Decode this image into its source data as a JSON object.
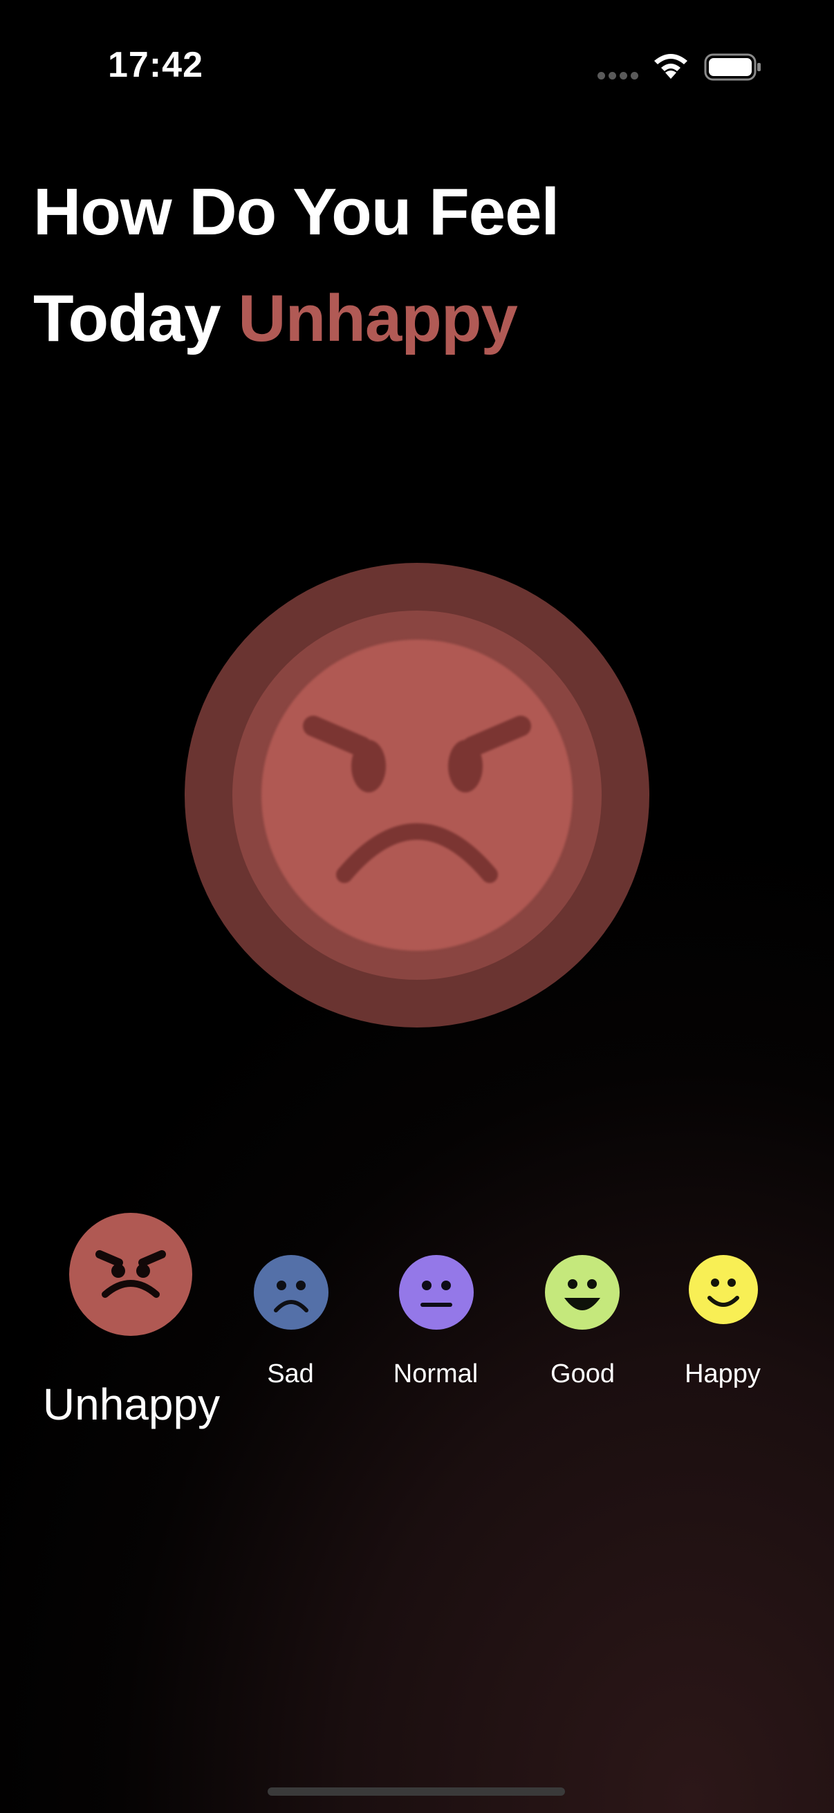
{
  "status_bar": {
    "time": "17:42"
  },
  "header": {
    "title_line1": "How Do You Feel",
    "title_line2_prefix": "Today",
    "selected_mood": "Unhappy"
  },
  "moods": [
    {
      "label": "Unhappy",
      "color": "#b05953",
      "icon": "angry-face-icon",
      "selected": true
    },
    {
      "label": "Sad",
      "color": "#5470a8",
      "icon": "sad-face-icon",
      "selected": false
    },
    {
      "label": "Normal",
      "color": "#9478e8",
      "icon": "neutral-face-icon",
      "selected": false
    },
    {
      "label": "Good",
      "color": "#c5e87c",
      "icon": "grinning-face-icon",
      "selected": false
    },
    {
      "label": "Happy",
      "color": "#f8ef55",
      "icon": "smiling-face-icon",
      "selected": false
    }
  ]
}
